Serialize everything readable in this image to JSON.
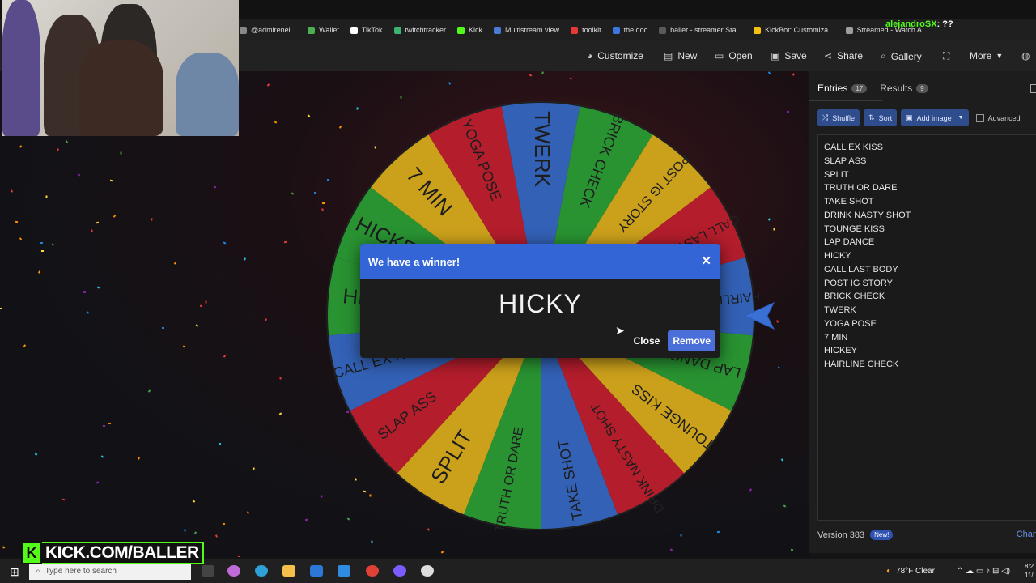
{
  "bookmarks": [
    {
      "label": "@admirenel...",
      "color": "#888888"
    },
    {
      "label": "Wallet",
      "color": "#4caf50"
    },
    {
      "label": "TikTok",
      "color": "#ffffff"
    },
    {
      "label": "twitchtracker",
      "color": "#3cb371"
    },
    {
      "label": "Kick",
      "color": "#53fc18"
    },
    {
      "label": "Multistream view",
      "color": "#4a7bd4"
    },
    {
      "label": "toolkit",
      "color": "#e53935"
    },
    {
      "label": "the doc",
      "color": "#3a78e0"
    },
    {
      "label": "baller - streamer Sta...",
      "color": "#5a5a5a"
    },
    {
      "label": "KickBot: Customiza...",
      "color": "#f4c20d"
    },
    {
      "label": "Streamed - Watch A...",
      "color": "#9e9e9e"
    }
  ],
  "toolbar": {
    "customize": "Customize",
    "new": "New",
    "open": "Open",
    "save": "Save",
    "share": "Share",
    "gallery": "Gallery",
    "more": "More"
  },
  "wheel": {
    "segments": [
      {
        "label": "TWERK",
        "color": "#3b6fd0"
      },
      {
        "label": "BRICK CHECK",
        "color": "#2fa83a"
      },
      {
        "label": "POST IG STORY",
        "color": "#e7b71f"
      },
      {
        "label": "CALL LAST BODY",
        "color": "#cc2233"
      },
      {
        "label": "HAIRLINE CHECK",
        "color": "#3b6fd0"
      },
      {
        "label": "LAP DANCE",
        "color": "#2fa83a"
      },
      {
        "label": "TOUNGE KISS",
        "color": "#e7b71f"
      },
      {
        "label": "DRINK NASTY SHOT",
        "color": "#cc2233"
      },
      {
        "label": "TAKE SHOT",
        "color": "#3b6fd0"
      },
      {
        "label": "TRUTH OR DARE",
        "color": "#2fa83a"
      },
      {
        "label": "SPLIT",
        "color": "#e7b71f"
      },
      {
        "label": "SLAP ASS",
        "color": "#cc2233"
      },
      {
        "label": "CALL EX KISS",
        "color": "#3b6fd0"
      },
      {
        "label": "HICKY",
        "color": "#2fa83a"
      },
      {
        "label": "HICKEY",
        "color": "#2fa83a"
      },
      {
        "label": "7 MIN",
        "color": "#e7b71f"
      },
      {
        "label": "YOGA POSE",
        "color": "#cc2233"
      }
    ]
  },
  "modal": {
    "title": "We have a winner!",
    "close_icon": "close-icon",
    "winner": "HICKY",
    "close_label": "Close",
    "remove_label": "Remove"
  },
  "panel": {
    "tabs": [
      {
        "label": "Entries",
        "count": "17"
      },
      {
        "label": "Results",
        "count": "9"
      }
    ],
    "tools": {
      "shuffle": "Shuffle",
      "sort": "Sort",
      "add_image": "Add image",
      "advanced": "Advanced"
    },
    "entries": [
      "CALL EX KISS",
      "SLAP ASS",
      "SPLIT",
      "TRUTH OR DARE",
      "TAKE SHOT",
      "DRINK NASTY SHOT",
      "TOUNGE KISS",
      "LAP DANCE",
      "HICKY",
      "CALL LAST BODY",
      "POST IG STORY",
      "BRICK CHECK",
      "TWERK",
      "YOGA POSE",
      "7 MIN",
      "HICKEY",
      "HAIRLINE CHECK"
    ],
    "version": "Version 383",
    "new_badge": "New!",
    "changelog": "Chan"
  },
  "chat": [
    {
      "user": "alejandroSX",
      "text": ": ??",
      "color": "#53fc18"
    }
  ],
  "overlay": {
    "kick": "KICK.COM/BALLER",
    "k": "K"
  },
  "taskbar": {
    "search_placeholder": "Type here to search",
    "weather": "78°F  Clear",
    "time": "8:2",
    "date": "11/"
  }
}
